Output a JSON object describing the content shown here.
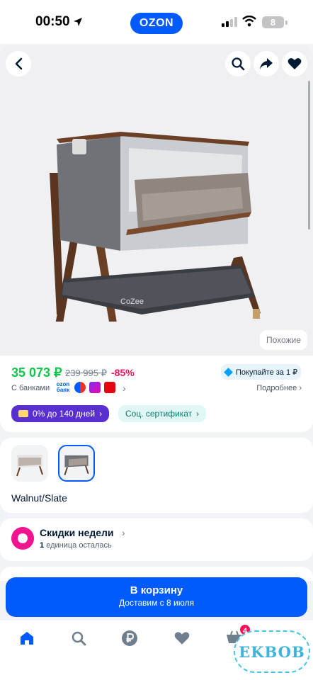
{
  "status_bar": {
    "time": "00:50",
    "brand": "OZON",
    "battery": "8"
  },
  "gallery": {
    "similar_label": "Похожие"
  },
  "price": {
    "current": "35 073 ₽",
    "old": "239 995 ₽",
    "discount": "-85%",
    "buy_for_label": "Покупайте за 1 ₽",
    "with_banks_label": "С банками",
    "bank_ozon": "ozon банк",
    "details_label": "Подробнее",
    "installment_label": "0% до 140 дней",
    "certificate_label": "Соц. сертификат"
  },
  "variants": {
    "selected_label": "Walnut/Slate"
  },
  "deals": {
    "title": "Скидки недели",
    "count": "1",
    "remaining_text": "единица осталась"
  },
  "cart": {
    "button_label": "В корзину",
    "delivery_text": "Доставим с 8 июля"
  },
  "tab_bar": {
    "cart_badge": "4"
  },
  "watermark": {
    "text": "EKBOB"
  },
  "colors": {
    "brand": "#005bff",
    "price": "#10c44c",
    "discount": "#f91155",
    "installment": "#5a2fd0"
  },
  "icons": [
    "location-arrow-icon",
    "signal-icon",
    "wifi-icon",
    "back-icon",
    "search-icon",
    "share-icon",
    "heart-icon",
    "home-icon",
    "catalog-search-icon",
    "ruble-icon",
    "cart-icon",
    "profile-icon"
  ]
}
